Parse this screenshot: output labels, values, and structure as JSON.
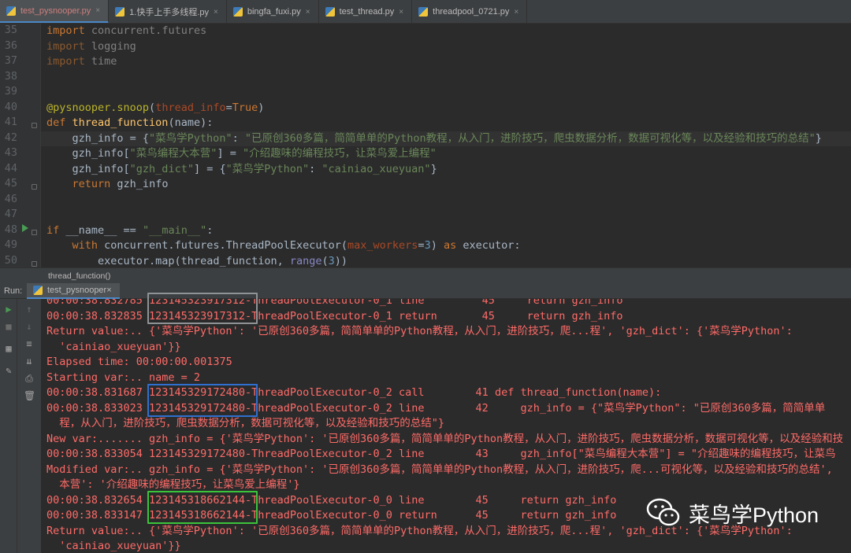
{
  "tabs": [
    {
      "label": "test_pysnooper.py",
      "active": true
    },
    {
      "label": "1.快手上手多线程.py",
      "active": false
    },
    {
      "label": "bingfa_fuxi.py",
      "active": false
    },
    {
      "label": "test_thread.py",
      "active": false
    },
    {
      "label": "threadpool_0721.py",
      "active": false
    }
  ],
  "close_glyph": "×",
  "line_numbers": [
    "35",
    "36",
    "37",
    "38",
    "39",
    "40",
    "41",
    "42",
    "43",
    "44",
    "45",
    "46",
    "47",
    "48",
    "49",
    "50"
  ],
  "code": {
    "l35": [
      "import",
      " concurrent.futures"
    ],
    "l36": [
      "import",
      " logging"
    ],
    "l37": [
      "import",
      " time"
    ],
    "l40": [
      "@pysnooper.snoop",
      "(",
      "thread_info",
      "=",
      "True",
      ")"
    ],
    "l41": [
      "def ",
      "thread_function",
      "(name):"
    ],
    "l42": [
      "    gzh_info = {",
      "\"菜鸟学Python\"",
      ": ",
      "\"已原创360多篇，简简单单的Python教程，从入门，进阶技巧，爬虫数据分析，数据可视化等，以及经验和技巧的总结\"",
      "}"
    ],
    "l43": [
      "    gzh_info[",
      "\"菜鸟编程大本营\"",
      "] = ",
      "\"介绍趣味的编程技巧，让菜鸟爱上编程\""
    ],
    "l44": [
      "    gzh_info[",
      "\"gzh_dict\"",
      "] = {",
      "\"菜鸟学Python\"",
      ": ",
      "\"cainiao_xueyuan\"",
      "}"
    ],
    "l45": [
      "    ",
      "return",
      " gzh_info"
    ],
    "l48": [
      "if",
      " __name__ == ",
      "\"__main__\"",
      ":"
    ],
    "l49": [
      "    ",
      "with",
      " concurrent.futures.ThreadPoolExecutor(",
      "max_workers",
      "=",
      "3",
      ") ",
      "as",
      " executor:"
    ],
    "l50": [
      "        executor.map(thread_function, ",
      "range",
      "(",
      "3",
      "))"
    ]
  },
  "breadcrumb": "thread_function()",
  "run": {
    "label": "Run:",
    "tab": "test_pysnooper"
  },
  "output": [
    "00:00:38.832785 123145323917312-ThreadPoolExecutor-0_1 line         45     return gzh_info",
    "00:00:38.832835 123145323917312-ThreadPoolExecutor-0_1 return       45     return gzh_info",
    "Return value:.. {'菜鸟学Python': '已原创360多篇，简简单单的Python教程，从入门，进阶技巧，爬...程', 'gzh_dict': {'菜鸟学Python':",
    "  'cainiao_xueyuan'}}",
    "Elapsed time: 00:00:00.001375",
    "Starting var:.. name = 2",
    "00:00:38.831687 123145329172480-ThreadPoolExecutor-0_2 call        41 def thread_function(name):",
    "00:00:38.833023 123145329172480-ThreadPoolExecutor-0_2 line        42     gzh_info = {\"菜鸟学Python\": \"已原创360多篇，简简单单",
    "  程，从入门，进阶技巧，爬虫数据分析，数据可视化等，以及经验和技巧的总结\"}",
    "New var:....... gzh_info = {'菜鸟学Python': '已原创360多篇，简简单单的Python教程，从入门，进阶技巧，爬虫数据分析，数据可视化等，以及经验和技",
    "00:00:38.833054 123145329172480-ThreadPoolExecutor-0_2 line        43     gzh_info[\"菜鸟编程大本营\"] = \"介绍趣味的编程技巧，让菜鸟",
    "Modified var:.. gzh_info = {'菜鸟学Python': '已原创360多篇，简简单单的Python教程，从入门，进阶技巧，爬...可视化等，以及经验和技巧的总结',",
    "  本营': '介绍趣味的编程技巧，让菜鸟爱上编程'}",
    "00:00:38.832654 123145318662144-ThreadPoolExecutor-0_0 line        45     return gzh_info",
    "00:00:38.833147 123145318662144-ThreadPoolExecutor-0_0 return      45     return gzh_info",
    "Return value:.. {'菜鸟学Python': '已原创360多篇，简简单单的Python教程，从入门，进阶技巧，爬...程', 'gzh_dict': {'菜鸟学Python':",
    "  'cainiao_xueyuan'}}"
  ],
  "highlight_colors": {
    "gray": "#8f9396",
    "blue": "#2f6fd0",
    "green": "#3ac43a"
  },
  "watermark": "菜鸟学Python"
}
